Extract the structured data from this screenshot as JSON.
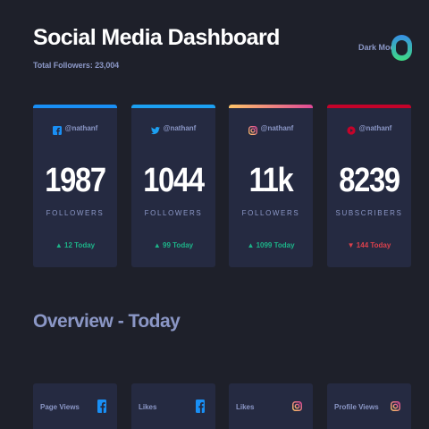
{
  "header": {
    "title": "Social Media Dashboard",
    "subtitle": "Total Followers: 23,004",
    "dark_mode_label": "Dark Mode"
  },
  "cards": [
    {
      "network": "facebook",
      "icon": "facebook-icon",
      "accent": "#198ff5",
      "handle": "@nathanf",
      "count": "1987",
      "unit": "FOLLOWERS",
      "today": "▲ 12 Today",
      "trend": "up"
    },
    {
      "network": "twitter",
      "icon": "twitter-icon",
      "accent": "#1ca0f2",
      "handle": "@nathanf",
      "count": "1044",
      "unit": "FOLLOWERS",
      "today": "▲ 99 Today",
      "trend": "up"
    },
    {
      "network": "instagram",
      "icon": "instagram-icon",
      "accent": "#fdc468",
      "handle": "@nathanf",
      "count": "11k",
      "unit": "FOLLOWERS",
      "today": "▲ 1099 Today",
      "trend": "up"
    },
    {
      "network": "youtube",
      "icon": "youtube-icon",
      "accent": "#c4032a",
      "handle": "@nathanf",
      "count": "8239",
      "unit": "SUBSCRIBERS",
      "today": "▼ 144 Today",
      "trend": "down"
    }
  ],
  "overview": {
    "title": "Overview - Today",
    "items": [
      {
        "label": "Page Views",
        "icon": "facebook-icon"
      },
      {
        "label": "Likes",
        "icon": "facebook-icon"
      },
      {
        "label": "Likes",
        "icon": "instagram-icon"
      },
      {
        "label": "Profile Views",
        "icon": "instagram-icon"
      }
    ]
  },
  "colors": {
    "background": "#1e202a",
    "card": "#252a41",
    "text_muted": "#8b97c6",
    "up": "#1db489",
    "down": "#dc414c"
  }
}
